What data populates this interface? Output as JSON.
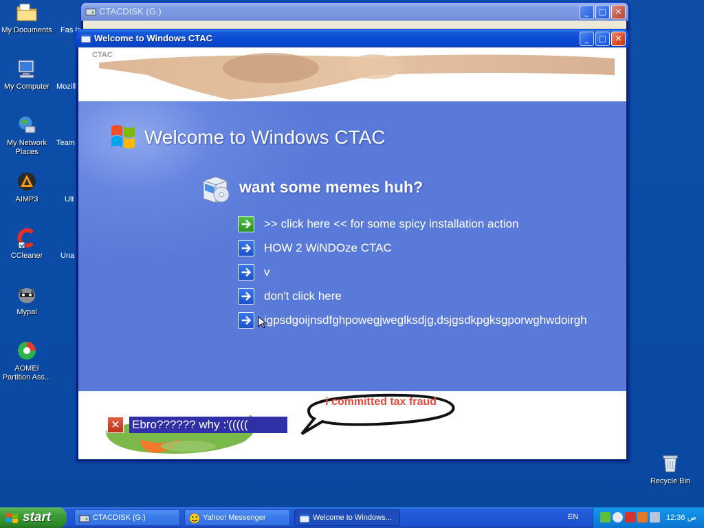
{
  "desktop": {
    "icons": [
      {
        "label": "My Documents"
      },
      {
        "label": "My Computer"
      },
      {
        "label": "My Network Places"
      },
      {
        "label": "AIMP3"
      },
      {
        "label": "CCleaner"
      },
      {
        "label": "Mypal"
      },
      {
        "label": "AOMEI Partition Ass..."
      }
    ],
    "cut_icons": [
      "Fas Imag",
      "Mozill",
      "Team",
      "Ult",
      "Una S"
    ],
    "recycle_bin": "Recycle Bin"
  },
  "back_window": {
    "title": "CTACDISK (G:)"
  },
  "welcome_window": {
    "title": "Welcome to Windows CTAC",
    "heading": "Welcome to Windows CTAC",
    "section_title": "want some memes huh?",
    "items": [
      {
        "label": ">> click here << for some spicy installation action",
        "icon": "green-arrow-icon"
      },
      {
        "label": " HOW 2 WiNDOze CTAC",
        "icon": "blue-arrow-icon"
      },
      {
        "label": "v",
        "icon": "blue-arrow-icon"
      },
      {
        "label": "don't click here",
        "icon": "blue-arrow-icon"
      },
      {
        "label": "igpsdgoijnsdfghpowegjweglksdjg,dsjgsdkpgksgporwghwdoirgh",
        "icon": "blue-arrow-icon"
      }
    ],
    "speech_bubble": "i committed tax fraud",
    "error_chip": "Ebro?????? why :'((((("
  },
  "taskbar": {
    "start_label": "start",
    "buttons": [
      {
        "label": "CTACDISK (G:)",
        "active": false
      },
      {
        "label": "Yahoo! Messenger",
        "active": false
      },
      {
        "label": "Welcome to Windows...",
        "active": true
      }
    ],
    "language": "EN",
    "clock": "12:36 ص"
  },
  "colors": {
    "desktop_blue": "#0b4fa8",
    "panel_blue": "#5a7ad9",
    "title_blue": "#0b49d2",
    "start_green": "#3c9a37"
  }
}
